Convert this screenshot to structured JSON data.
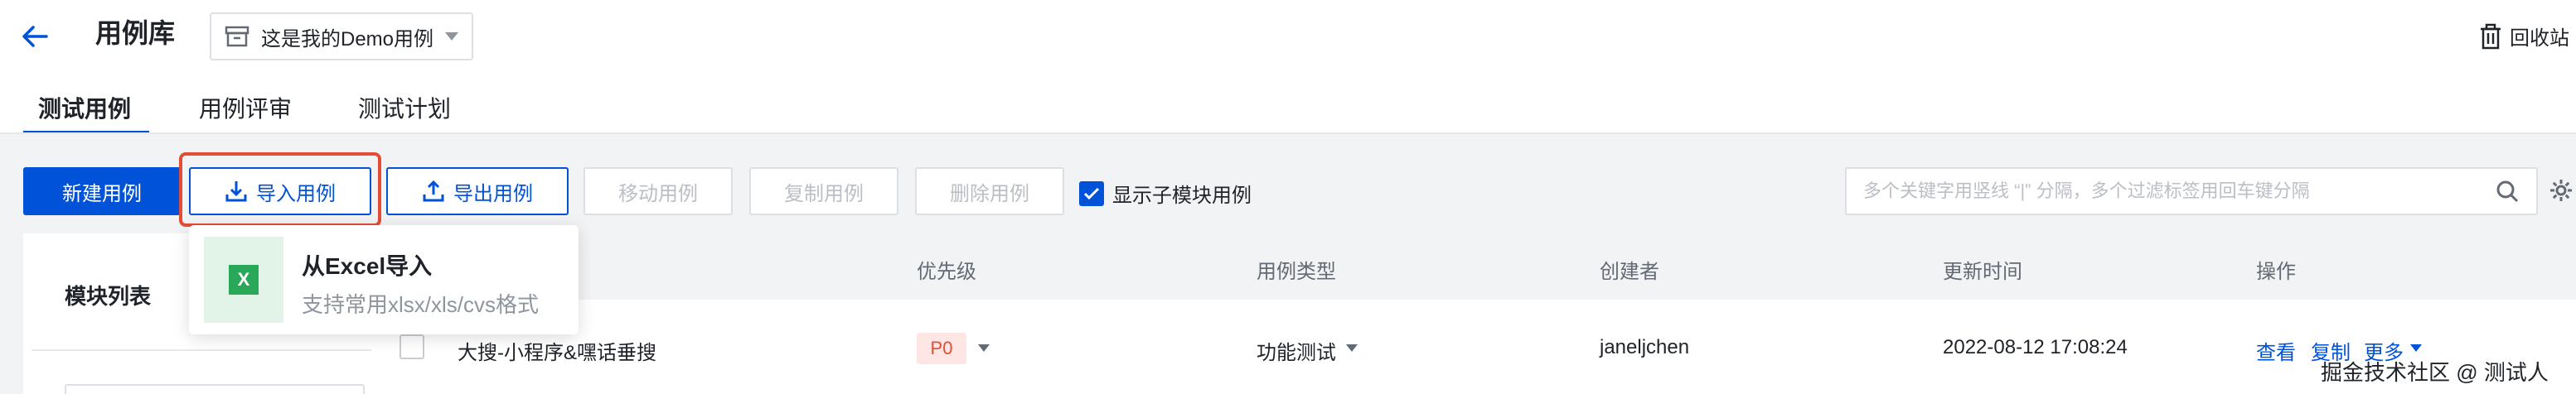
{
  "header": {
    "title": "用例库",
    "project_name": "这是我的Demo用例",
    "recycle_label": "回收站"
  },
  "tabs": [
    {
      "label": "测试用例",
      "active": true
    },
    {
      "label": "用例评审",
      "active": false
    },
    {
      "label": "测试计划",
      "active": false
    }
  ],
  "toolbar": {
    "new_case": "新建用例",
    "import_case": "导入用例",
    "export_case": "导出用例",
    "move_case": "移动用例",
    "copy_case": "复制用例",
    "delete_case": "删除用例",
    "show_submodule": "显示子模块用例",
    "show_submodule_checked": true,
    "search_placeholder": "多个关键字用竖线 “|” 分隔，多个过滤标签用回车键分隔"
  },
  "left_panel": {
    "title": "模块列表"
  },
  "table": {
    "columns": {
      "priority": "优先级",
      "case_type": "用例类型",
      "creator": "创建者",
      "updated": "更新时间",
      "actions": "操作"
    },
    "rows": [
      {
        "name": "大搜-小程序&嘿话垂搜",
        "priority": "P0",
        "case_type": "功能测试",
        "creator": "janeljchen",
        "updated": "2022-08-12 17:08:24",
        "actions": {
          "view": "查看",
          "copy": "复制",
          "more": "更多"
        }
      }
    ]
  },
  "import_dropdown": {
    "title": "从Excel导入",
    "description": "支持常用xlsx/xls/cvs格式",
    "icon_letter": "X"
  },
  "watermark": "掘金技术社区 @ 测试人",
  "colors": {
    "primary": "#0052d9",
    "highlight": "#e34d36",
    "excel_green": "#2aa85a"
  }
}
